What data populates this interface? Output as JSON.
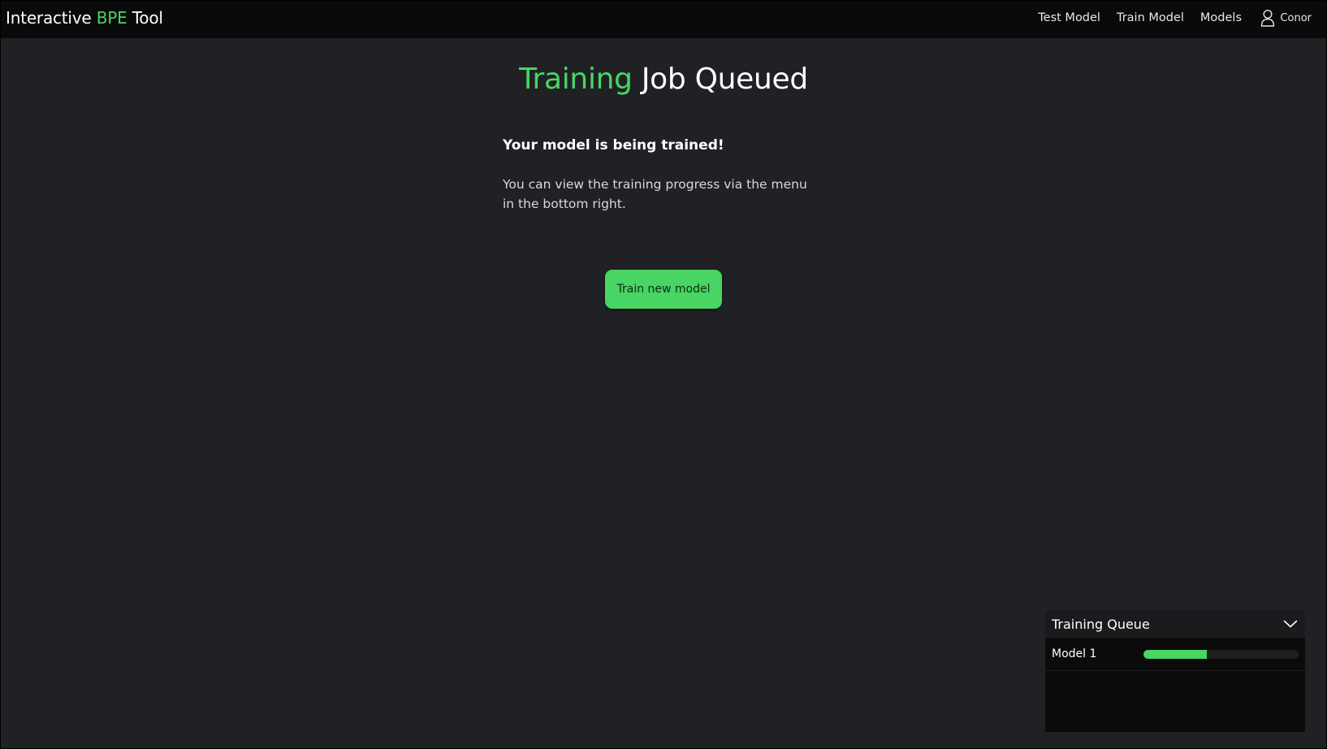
{
  "navbar": {
    "brand_prefix": "Interactive ",
    "brand_accent": "BPE",
    "brand_suffix": " Tool",
    "links": [
      "Test Model",
      "Train Model",
      "Models"
    ],
    "user_name": "Conor",
    "user_icon": "user-icon"
  },
  "main": {
    "title_accent": "Training",
    "title_rest": " Job Queued",
    "lead": "Your model is being trained!",
    "description": "You can view the training progress via the menu in the bottom right.",
    "button_label": "Train new model"
  },
  "queue": {
    "title": "Training Queue",
    "toggle_icon": "chevron-down-icon",
    "items": [
      {
        "name": "Model 1",
        "progress": 0.41
      }
    ]
  },
  "colors": {
    "accent": "#48d563",
    "background": "#202124",
    "navbar": "#0a0a0a"
  }
}
